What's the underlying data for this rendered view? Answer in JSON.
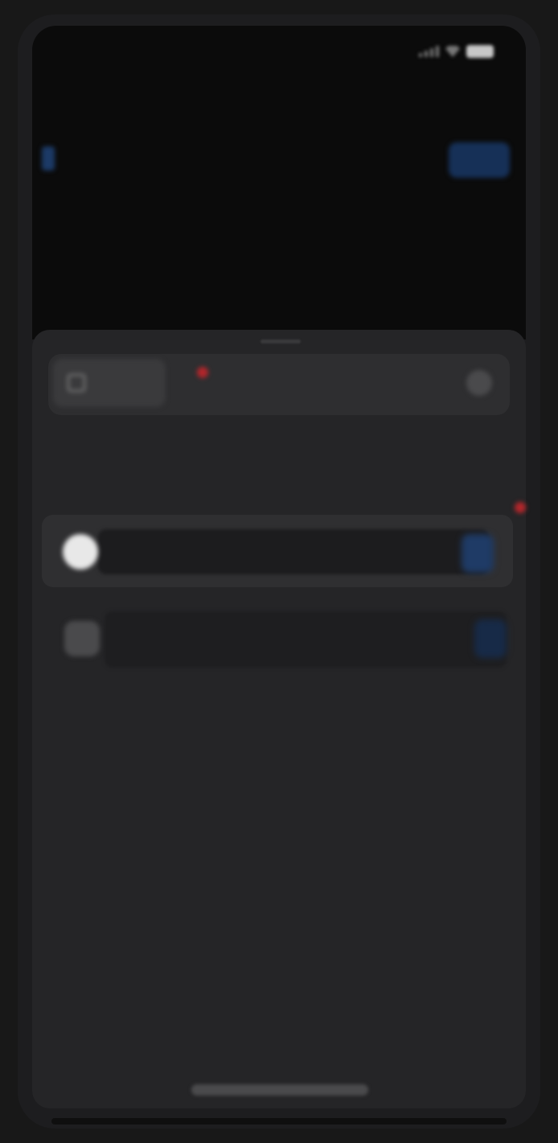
{
  "status": {
    "time": "",
    "signal_icon": "signal-bars-icon",
    "wifi_icon": "wifi-icon",
    "battery_icon": "battery-icon"
  },
  "nav": {
    "back_icon": "chevron-left-icon",
    "action_label": ""
  },
  "header": {
    "title_line1": "",
    "title_line2": ""
  },
  "filter": {
    "chip_icon": "checkbox-icon",
    "chip_label": "",
    "gear_icon": "gear-icon"
  },
  "section": {
    "title": ""
  },
  "options": [
    {
      "label": "",
      "selected": true
    },
    {
      "label": "",
      "selected": false
    }
  ],
  "colors": {
    "background": "#181818",
    "sheet": "#252527",
    "accent_blue": "#1f3b66",
    "badge_red": "#b3262b"
  }
}
